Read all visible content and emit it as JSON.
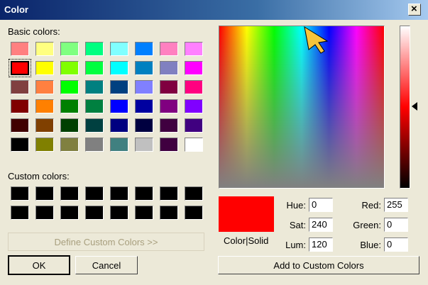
{
  "window": {
    "title": "Color",
    "close_glyph": "×"
  },
  "basic": {
    "label": "Basic colors:",
    "colors": [
      "#ff8080",
      "#ffff80",
      "#80ff80",
      "#00ff80",
      "#80ffff",
      "#0080ff",
      "#ff80c0",
      "#ff80ff",
      "#ff0000",
      "#ffff00",
      "#80ff00",
      "#00ff40",
      "#00ffff",
      "#0080c0",
      "#8080c0",
      "#ff00ff",
      "#804040",
      "#ff8040",
      "#00ff00",
      "#008080",
      "#004080",
      "#8080ff",
      "#800040",
      "#ff0080",
      "#800000",
      "#ff8000",
      "#008000",
      "#008040",
      "#0000ff",
      "#0000a0",
      "#800080",
      "#8000ff",
      "#400000",
      "#804000",
      "#004000",
      "#004040",
      "#000080",
      "#000040",
      "#400040",
      "#400080",
      "#000000",
      "#808000",
      "#808040",
      "#808080",
      "#408080",
      "#c0c0c0",
      "#400040",
      "#ffffff"
    ],
    "selected_index": 8
  },
  "custom": {
    "label": "Custom colors:",
    "colors": [
      "#000000",
      "#000000",
      "#000000",
      "#000000",
      "#000000",
      "#000000",
      "#000000",
      "#000000",
      "#000000",
      "#000000",
      "#000000",
      "#000000",
      "#000000",
      "#000000",
      "#000000",
      "#000000"
    ]
  },
  "buttons": {
    "define_custom": "Define Custom Colors >>",
    "ok": "OK",
    "cancel": "Cancel",
    "add_custom": "Add to Custom Colors"
  },
  "preview": {
    "label": "Color|Solid",
    "color": "#ff0000"
  },
  "fields": {
    "hue_label": "Hue:",
    "hue": "0",
    "sat_label": "Sat:",
    "sat": "240",
    "lum_label": "Lum:",
    "lum": "120",
    "red_label": "Red:",
    "red": "255",
    "green_label": "Green:",
    "green": "0",
    "blue_label": "Blue:",
    "blue": "0"
  }
}
